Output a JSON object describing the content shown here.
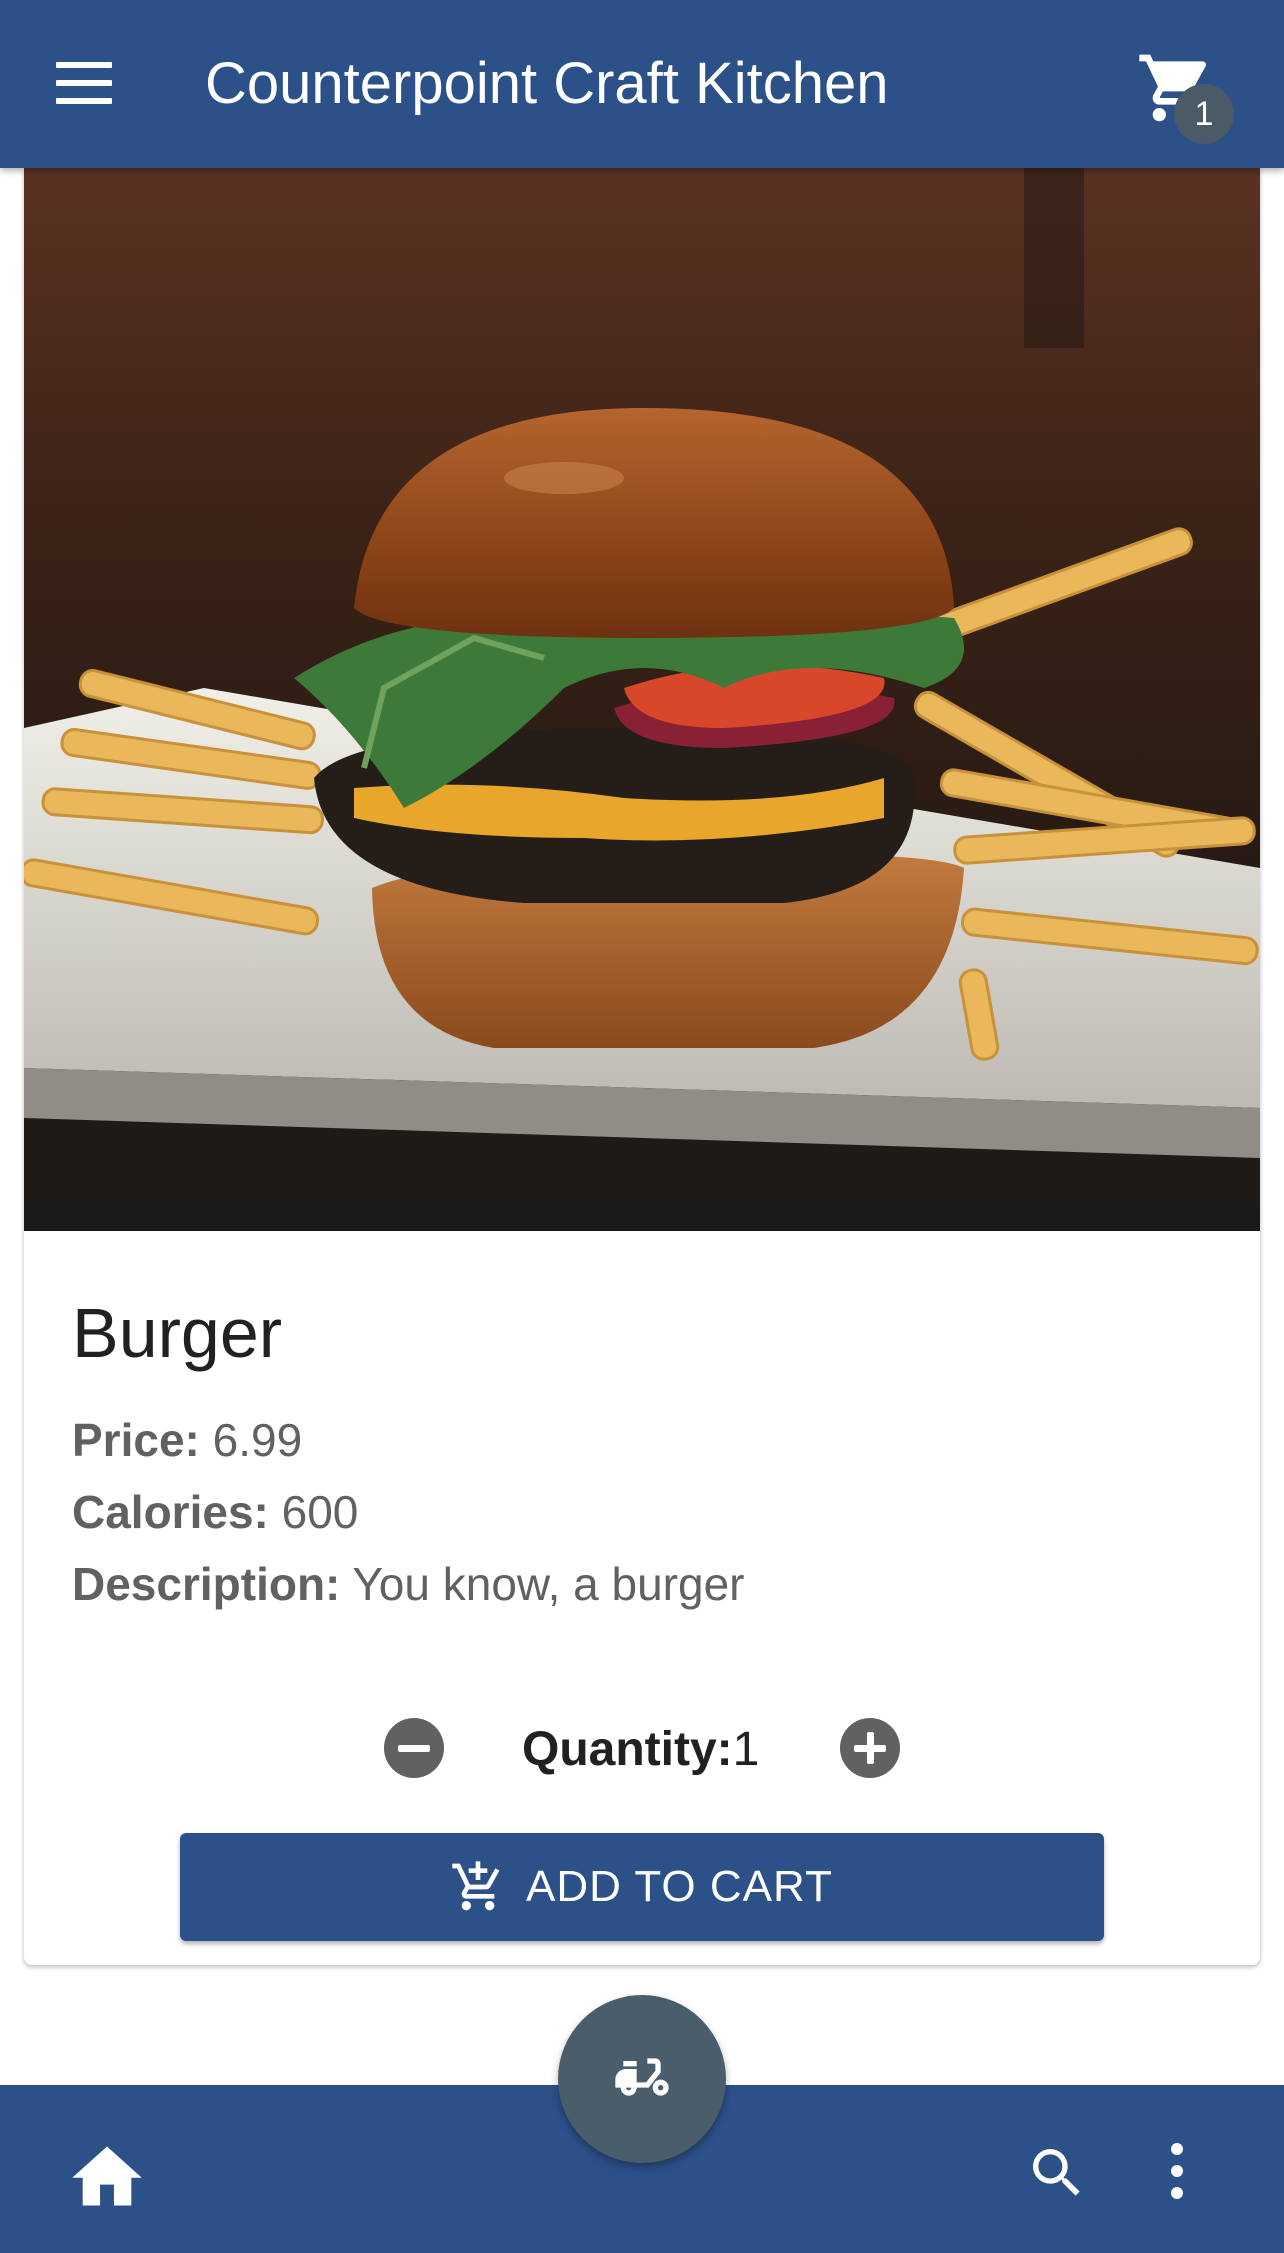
{
  "app_bar": {
    "title": "Counterpoint Craft Kitchen",
    "menu_icon": "hamburger-menu-icon",
    "cart_icon": "shopping-cart-icon",
    "cart_count": "1"
  },
  "product": {
    "image_description": "burger-with-fries-photo",
    "name": "Burger",
    "price_label": "Price:",
    "price_value": "6.99",
    "calories_label": "Calories:",
    "calories_value": "600",
    "description_label": "Description:",
    "description_value": "You know, a burger"
  },
  "quantity": {
    "label": "Quantity:",
    "value": "1",
    "decrement_icon": "minus-circle-icon",
    "increment_icon": "plus-circle-icon"
  },
  "add_to_cart": {
    "label": "ADD TO CART",
    "icon": "cart-plus-icon"
  },
  "bottom_bar": {
    "home_icon": "home-icon",
    "search_icon": "search-icon",
    "more_icon": "more-vertical-icon",
    "fab_icon": "delivery-scooter-icon"
  },
  "colors": {
    "primary": "#2c5088",
    "fab": "#4a5d6b",
    "badge": "#4a5a66",
    "secondary_text": "#616161"
  }
}
